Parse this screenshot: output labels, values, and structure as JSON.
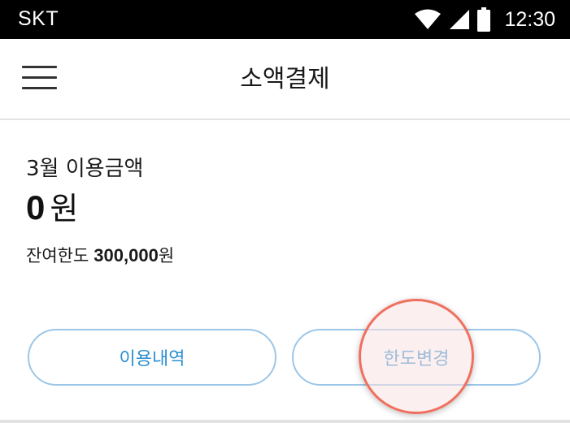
{
  "status_bar": {
    "carrier": "SKT",
    "time": "12:30",
    "icons": [
      "wifi-icon",
      "cell-signal-icon",
      "battery-icon"
    ]
  },
  "header": {
    "title": "소액결제",
    "menu_icon": "hamburger-menu-icon"
  },
  "summary": {
    "usage_label": "3월 이용금액",
    "usage_amount": "0",
    "usage_unit": "원",
    "limit_label": "잔여한도",
    "limit_amount": "300,000",
    "limit_unit": "원"
  },
  "buttons": {
    "history_label": "이용내역",
    "change_limit_label": "한도변경"
  },
  "colors": {
    "status_bar_bg": "#000000",
    "button_border": "#9cc6e8",
    "button_text": "#2d8fd0",
    "tap_indicator": "#f0705e",
    "divider": "#e2e2e2"
  }
}
